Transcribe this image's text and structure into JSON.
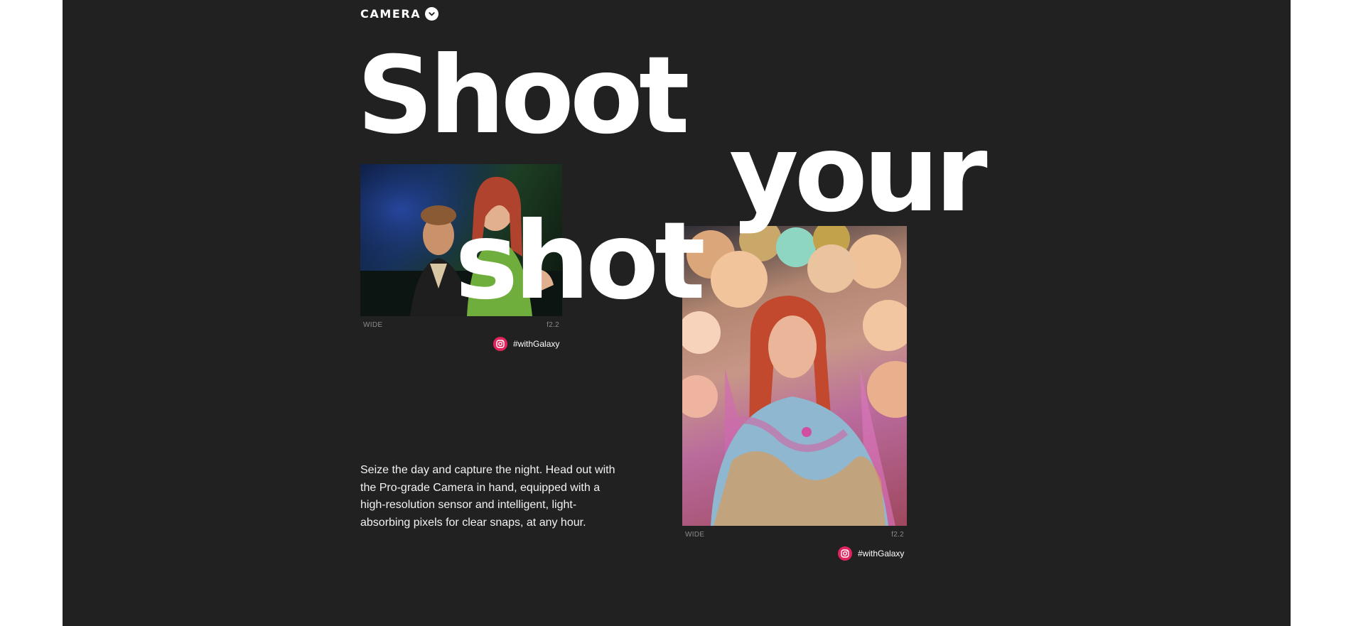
{
  "section": {
    "label": "CAMERA",
    "chevron_icon": "chevron-down-icon"
  },
  "headline": {
    "word1": "Shoot",
    "word2": "your",
    "word3": "shot"
  },
  "photos": [
    {
      "lens": "WIDE",
      "aperture": "f2.2",
      "hashtag": "#withGalaxy",
      "icon": "instagram-icon"
    },
    {
      "lens": "WIDE",
      "aperture": "f2.2",
      "hashtag": "#withGalaxy",
      "icon": "instagram-icon"
    }
  ],
  "body_text": "Seize the day and capture the night. Head out with the Pro-grade Camera in hand, equipped with a high-resolution sensor and intelligent, light-absorbing pixels for clear snaps, at any hour.",
  "colors": {
    "background": "#212121",
    "page_margin": "#ffffff",
    "text": "#ffffff",
    "caption": "#8a8a8a",
    "instagram_accent": "#e0245e"
  }
}
